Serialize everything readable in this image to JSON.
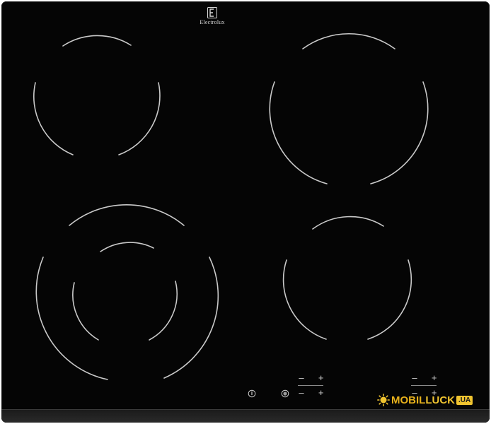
{
  "brand": {
    "name": "Electrolux",
    "logo_icon": "electrolux-logo-icon"
  },
  "cooktop": {
    "surface_color": "#050505",
    "zone_line_color": "#c9c9c9",
    "zones": [
      {
        "position": "top-left",
        "type": "single"
      },
      {
        "position": "top-right",
        "type": "single"
      },
      {
        "position": "bottom-left",
        "type": "dual"
      },
      {
        "position": "bottom-right",
        "type": "single"
      }
    ]
  },
  "controls": {
    "minus_symbol": "–",
    "plus_symbol": "+",
    "power_icon": "power-icon",
    "lock_icon": "lock-icon"
  },
  "watermark": {
    "mobil": "MOBIL",
    "luck": "LUCK",
    "ua": ".UA",
    "icon": "sun-icon",
    "color": "#f0c430"
  }
}
